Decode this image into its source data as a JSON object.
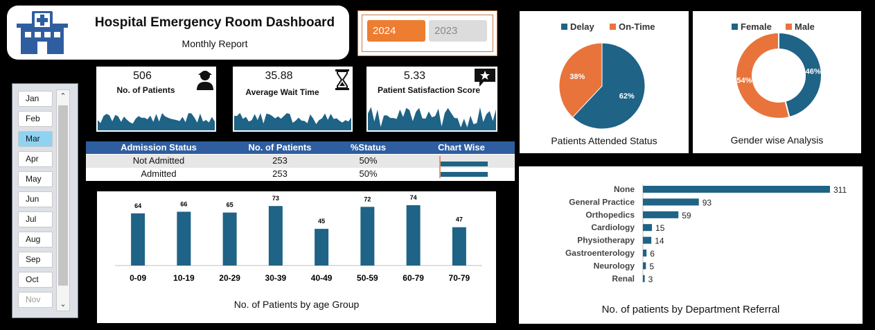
{
  "header": {
    "title": "Hospital Emergency Room Dashboard",
    "subtitle": "Monthly Report"
  },
  "years": {
    "active": "2024",
    "inactive": "2023"
  },
  "months": [
    "Jan",
    "Feb",
    "Mar",
    "Apr",
    "May",
    "Jun",
    "Jul",
    "Aug",
    "Sep",
    "Oct",
    "Nov"
  ],
  "selected_month": "Mar",
  "kpis": [
    {
      "value": "506",
      "label": "No. of Patients",
      "icon": "user-icon"
    },
    {
      "value": "35.88",
      "label": "Average Wait Time",
      "icon": "hourglass-icon"
    },
    {
      "value": "5.33",
      "label": "Patient Satisfaction Score",
      "icon": "star-chat-icon"
    }
  ],
  "admission": {
    "headers": [
      "Admission Status",
      "No. of Patients",
      "%Status",
      "Chart Wise"
    ],
    "rows": [
      {
        "status": "Not Admitted",
        "count": "253",
        "pct": "50%",
        "fraction": 0.5
      },
      {
        "status": "Admitted",
        "count": "253",
        "pct": "50%",
        "fraction": 0.5
      }
    ]
  },
  "colors": {
    "blue": "#1f6386",
    "orange": "#e8743b",
    "header_blue": "#2e5ea0"
  },
  "chart_data": [
    {
      "type": "bar",
      "title": "No. of Patients by age Group",
      "categories": [
        "0-09",
        "10-19",
        "20-29",
        "30-39",
        "40-49",
        "50-59",
        "60-79",
        "70-79"
      ],
      "values": [
        64,
        66,
        65,
        73,
        45,
        72,
        74,
        47
      ]
    },
    {
      "type": "pie",
      "title": "Patients Attended Status",
      "labels": [
        "Delay",
        "On-Time"
      ],
      "values": [
        62,
        38
      ],
      "value_labels": [
        "62%",
        "38%"
      ],
      "legend": "top"
    },
    {
      "type": "pie",
      "subtype": "donut",
      "title": "Gender wise Analysis",
      "labels": [
        "Female",
        "Male"
      ],
      "values": [
        46,
        54
      ],
      "value_labels": [
        "46%",
        "54%"
      ],
      "legend": "top"
    },
    {
      "type": "bar",
      "orientation": "horizontal",
      "title": "No. of patients by Department Referral",
      "categories": [
        "None",
        "General Practice",
        "Orthopedics",
        "Cardiology",
        "Physiotherapy",
        "Gastroenterology",
        "Neurology",
        "Renal"
      ],
      "values": [
        311,
        93,
        59,
        15,
        14,
        6,
        5,
        3
      ]
    }
  ]
}
